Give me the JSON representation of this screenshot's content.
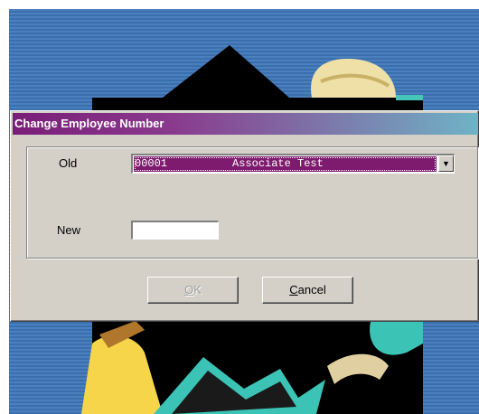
{
  "dialog": {
    "title": "Change Employee Number",
    "old_label": "Old",
    "new_label": "New",
    "old_value": "00001          Associate Test",
    "new_value": "",
    "ok_label_underlined": "O",
    "ok_label_rest": "K",
    "ok_enabled": false,
    "cancel_label_underlined": "C",
    "cancel_label_rest": "ancel"
  },
  "icons": {
    "dropdown": "chevron-down-icon"
  },
  "colors": {
    "title_gradient_start": "#7a1d78",
    "title_gradient_end": "#6fb3c6",
    "selection": "#7e1b6e",
    "dialog_face": "#d4d0c8"
  }
}
